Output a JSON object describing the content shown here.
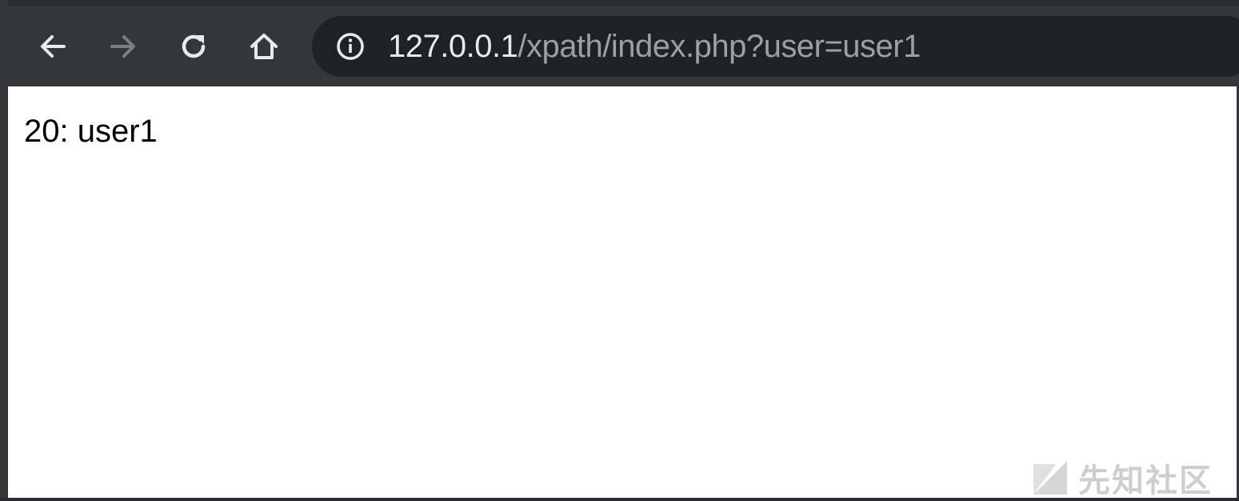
{
  "browser": {
    "nav": {
      "back_icon": "back-arrow-icon",
      "forward_icon": "forward-arrow-icon",
      "reload_icon": "reload-icon",
      "home_icon": "home-icon"
    },
    "address_bar": {
      "info_icon": "info-icon",
      "url_host": "127.0.0.1",
      "url_path": "/xpath/index.php?user=user1"
    },
    "colors": {
      "toolbar": "#35363a",
      "omnibox": "#202124",
      "url_host": "#e8eaed",
      "url_path": "#9aa0a6"
    }
  },
  "page": {
    "output": "20: user1"
  },
  "watermark": {
    "text": "先知社区"
  }
}
